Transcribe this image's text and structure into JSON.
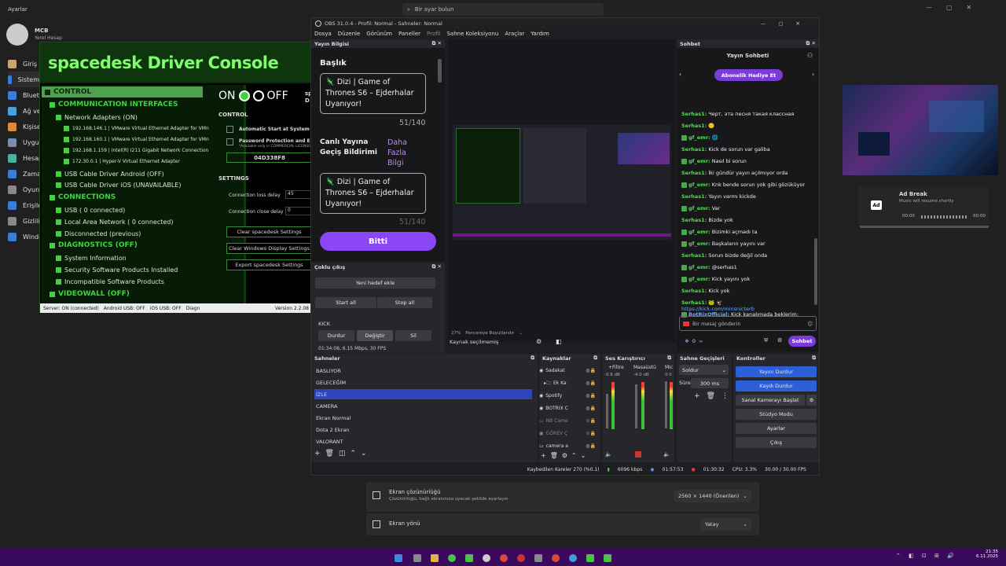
{
  "taskbar_search": {
    "placeholder": "Bir ayar bulun"
  },
  "settings": {
    "window_title": "Ayarlar",
    "user": {
      "name": "MCB",
      "sub": "Yerel Hesap"
    },
    "nav": [
      "Giriş",
      "Sistem",
      "Blueto",
      "Ağ ve",
      "Kişisell",
      "Uygula",
      "Hesapl",
      "Zaman",
      "Oyun",
      "Erişileb",
      "Gizlilik",
      "Windo"
    ],
    "resolution": {
      "title": "Ekran çözünürlüğü",
      "desc": "Çözünürlüğü, bağlı ekranınıza uyacak şekilde ayarlayın",
      "value": "2560 × 1440 (Önerilen)"
    },
    "orientation": {
      "title": "Ekran yönü",
      "value": "Yatay"
    }
  },
  "spacedesk": {
    "title": "spacedesk Driver Console",
    "tree": {
      "control": "CONTROL",
      "comm": "COMMUNICATION INTERFACES",
      "netad": "Network Adapters (ON)",
      "a1": "192.168.146.1 | VMware Virtual Ethernet Adapter for VMn",
      "a2": "192.168.160.1 | VMware Virtual Ethernet Adapter for VMn",
      "a3": "192.168.1.159 | Intel(R) I211 Gigabit Network Connection",
      "a4": "172.30.0.1 | Hyper-V Virtual Ethernet Adapter",
      "usb_android": "USB Cable Driver Android (OFF)",
      "usb_ios": "USB Cable Driver iOS (UNAVAILABLE)",
      "connections": "CONNECTIONS",
      "usb": "USB ( 0 connected)",
      "lan": "Local Area Network ( 0 connected)",
      "disc": "Disconnected (previous)",
      "diag": "DIAGNOSTICS (OFF)",
      "sysinfo": "System Information",
      "sec": "Security Software Products Installed",
      "incompat": "Incompatible Software Products",
      "vwall": "VIDEOWALL (OFF)"
    },
    "right": {
      "on": "ON",
      "off": "OFF",
      "sp": "sp",
      "d": "D",
      "control_h": "CONTROL",
      "auto_start": "Automatic Start at System B",
      "pwd": "Password Protection and En",
      "pwd_note": "*Available only in COMMERCIAL LICENSE",
      "code": "04D338F8",
      "settings_h": "SETTINGS",
      "loss_label": "Connection loss delay",
      "loss_val": "45",
      "close_label": "Connection close delay",
      "close_val": "0",
      "btn1": "Clear spacedesk Settings",
      "btn2": "Clear Windows Display Settings",
      "btn3": "Export spacedesk Settings"
    },
    "footer": {
      "s1": "Server: ON (connected)",
      "s2": "Android USB: OFF",
      "s3": "iOS USB: OFF",
      "s4": "Diagn",
      "version": "Version 2.2.08"
    }
  },
  "obs": {
    "title": "OBS 31.0.4 - Profil: Normal - Sahneler: Normal",
    "menu": [
      "Dosya",
      "Düzenle",
      "Görünüm",
      "Paneller",
      "Profil",
      "Sahne Koleksiyonu",
      "Araçlar",
      "Yardım"
    ],
    "stream_info": {
      "header": "Yayın Bilgisi",
      "baslik": "Başlık",
      "title_text": "🦎 Dizi | Game of Thrones S6 – Ejderhalar Uyanıyor!",
      "count1": "51/140",
      "notif": "Canlı Yayına Geçiş Bildirimi",
      "more": "Daha Fazla Bilgi",
      "count2": "51/140",
      "done": "Bitti"
    },
    "multi": {
      "header": "Çoklu çıkış",
      "add": "Yeni hedef ekle",
      "start": "Start all",
      "stop": "Stop all",
      "kick": "KICK",
      "dur": "Durdur",
      "degis": "Değiştir",
      "sil": "Sil",
      "stats": "01:34:08, 6.15 Mbps, 30 FPS"
    },
    "preview": {
      "zoom": "27%",
      "fit": "Pencereye Boyutlandır",
      "no_source": "Kaynak seçilmemiş"
    },
    "chat": {
      "header": "Sohbet",
      "title": "Yayın Sohbeti",
      "gift": "Abonelik Hediye Et",
      "placeholder": "Bir mesaj gönderin",
      "send": "Sohbet",
      "count": "0",
      "inf": "∞",
      "lines": [
        {
          "u": "Serhas1:",
          "t": "Черт, эта песня такая классная"
        },
        {
          "u": "Serhas1:",
          "t": "🙂"
        },
        {
          "u": "gf_emr:",
          "t": "🌐"
        },
        {
          "u": "Serhas1:",
          "t": "Kick de sorun var galiba"
        },
        {
          "u": "gf_emr:",
          "t": "Nasıl bi sorun"
        },
        {
          "u": "Serhas1:",
          "t": "İki gündür yayın açılmıyor orda"
        },
        {
          "u": "gf_emr:",
          "t": "Knk bende sorun yok gibi gözüküyor"
        },
        {
          "u": "Serhas1:",
          "t": "Yayın varmı kickde"
        },
        {
          "u": "gf_emr:",
          "t": "Var"
        },
        {
          "u": "Serhas1:",
          "t": "Bizde yok"
        },
        {
          "u": "gf_emr:",
          "t": "Bizimki açmadı ta"
        },
        {
          "u": "gf_emr:",
          "t": "Başkaların yayını var"
        },
        {
          "u": "Serhas1:",
          "t": "Sorun bizde değil onda"
        },
        {
          "u": "gf_emr:",
          "t": "@serhas1"
        },
        {
          "u": "gf_emr:",
          "t": "Kick yayını yok"
        },
        {
          "u": "Serhas1:",
          "t": "Kick yok"
        },
        {
          "u": "Serhas1:",
          "t": "🐸 🦅"
        },
        {
          "u": "BotRixOfficial:",
          "t": "Kick kanalımada beklerim:"
        }
      ],
      "link": "https://kick.com/minsnicterb"
    },
    "scenes": {
      "header": "Sahneler",
      "items": [
        "BASLIYOR",
        "GELECEĞİM",
        "İZLE",
        "CAMERA",
        "Ekran Normal",
        "Dota 2 Ekran",
        "VALORANT"
      ]
    },
    "sources": {
      "header": "Kaynaklar",
      "items": [
        "Sadakat",
        "Ek Ka",
        "Spotify",
        "BOTRIX C",
        "NB Came",
        "GÖREV Ç",
        "camera a"
      ]
    },
    "mixer": {
      "header": "Ses Karıştırıcı",
      "ch1": "+Filtre",
      "ch2": "Masaüstü",
      "ch3": "Mic",
      "db1": "-9.8 dB",
      "db2": "-4.0 dB",
      "db3": "0.0"
    },
    "transitions": {
      "header": "Sahne Geçişleri",
      "type": "Soldur",
      "dur_label": "Süre",
      "dur_val": "300 ms"
    },
    "controls": {
      "header": "Kontroller",
      "b1": "Yayını Durdur",
      "b2": "Kaydı Durdur",
      "b3": "Sanal Kamerayı Başlat",
      "b4": "Stüdyo Modu",
      "b5": "Ayarlar",
      "b6": "Çıkış"
    },
    "status": {
      "dropped": "Kaybedilen Kareler 270 (%0.1)",
      "kbps": "6096 kbps",
      "t1": "01:57:53",
      "t2": "01:30:32",
      "cpu": "CPU: 3.3%",
      "fps": "30.00 / 30.00 FPS"
    }
  },
  "media": {
    "title": "Ad Break",
    "sub": "Music will resume shortly",
    "t0": "00:00",
    "t1": "00:00",
    "badge": "Ad"
  },
  "clock": {
    "time": "21:35",
    "date": "6.11.2025"
  }
}
